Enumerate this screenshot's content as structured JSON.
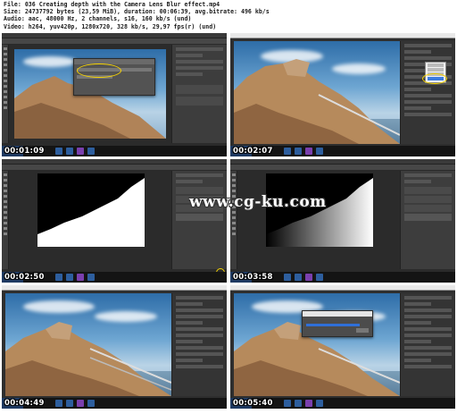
{
  "header": {
    "file_line": "File: 036 Creating depth with the Camera Lens Blur effect.mp4",
    "size_line": "Size: 24737792 bytes (23,59 MiB), duration: 00:06:39, avg.bitrate: 496 kb/s",
    "audio_line": "Audio: aac, 48000 Hz, 2 channels, s16, 160 kb/s (und)",
    "video_line": "Video: h264, yuv420p, 1280x720, 328 kb/s, 29,97 fps(r) (und)"
  },
  "thumbnails": [
    {
      "timestamp": "00:01:09",
      "view": "photoshop-dialog"
    },
    {
      "timestamp": "00:02:07",
      "view": "camera-raw-depth-menu"
    },
    {
      "timestamp": "00:02:50",
      "view": "mask-black-white"
    },
    {
      "timestamp": "00:03:58",
      "view": "mask-gradient"
    },
    {
      "timestamp": "00:04:49",
      "view": "camera-raw-photo"
    },
    {
      "timestamp": "00:05:40",
      "view": "camera-raw-progress"
    }
  ],
  "watermark": "www.cg-ku.com",
  "colors": {
    "highlight": "#f5d200",
    "progress": "#2f6fd8",
    "photoshop_ui": "#2b2b2b",
    "camera_raw_ui": "#2e2e2e"
  }
}
